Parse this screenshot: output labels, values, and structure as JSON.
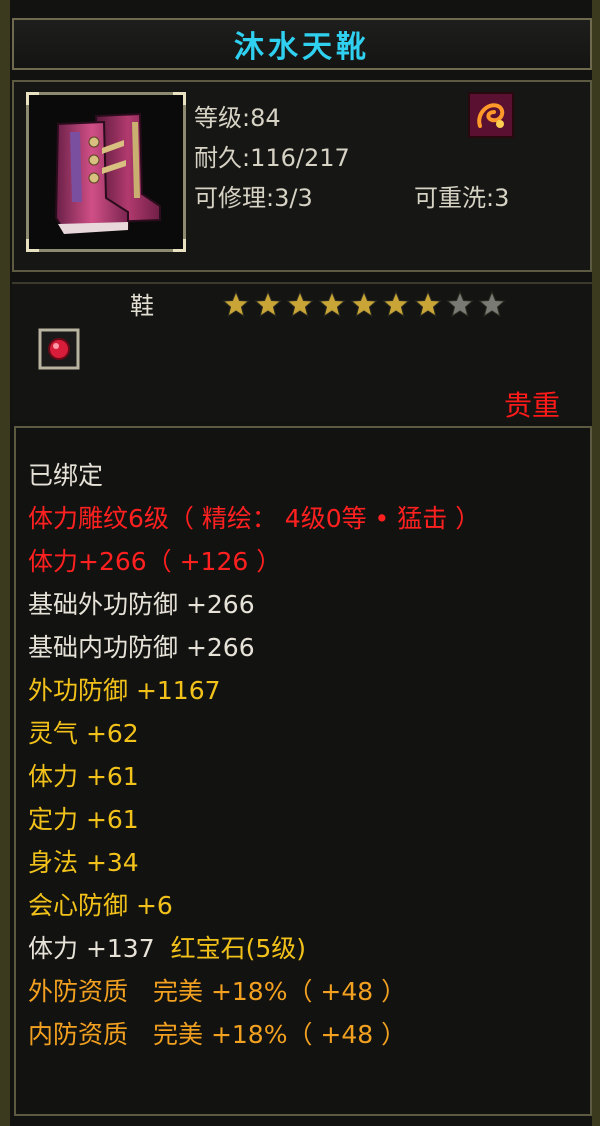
{
  "item": {
    "name": "沐水天靴",
    "level_line": "等级:84",
    "durability_line": "耐久:116/217",
    "repair_line": "可修理:3/3",
    "rewash_line": "可重洗:3",
    "type": "鞋",
    "stars_filled": 7,
    "stars_total": 9,
    "rarity": "贵重"
  },
  "colors": {
    "title": "#2fd0f0",
    "red": "#ff2020",
    "white": "#e6e2d8",
    "yellow": "#f2c21a",
    "orange": "#f2a020",
    "star_gold": "#c9a436",
    "star_gray": "#7a7a74"
  },
  "icons": {
    "item": "boots-icon",
    "rune": "swirl-rune-icon",
    "gem_slot": "red-gem-socket-icon",
    "star": "star-icon"
  },
  "properties": [
    {
      "text": "已绑定",
      "color": "#e6e2d8"
    },
    {
      "text": "体力雕纹6级（ 精绘： 4级0等 • 猛击 ）",
      "color": "#ff2020"
    },
    {
      "text": "体力+266（ +126 ）",
      "color": "#ff2020"
    },
    {
      "text": "基础外功防御 +266",
      "color": "#e6e2d8"
    },
    {
      "text": "基础内功防御 +266",
      "color": "#e6e2d8"
    },
    {
      "text": "外功防御 +1167",
      "color": "#f2c21a"
    },
    {
      "text": "灵气 +62",
      "color": "#f2c21a"
    },
    {
      "text": "体力 +61",
      "color": "#f2c21a"
    },
    {
      "text": "定力 +61",
      "color": "#f2c21a"
    },
    {
      "text": "身法 +34",
      "color": "#f2c21a"
    },
    {
      "text": "会心防御 +6",
      "color": "#f2c21a"
    },
    {
      "text": "体力 +137",
      "color": "#e6e2d8",
      "extra": "红宝石(5级)",
      "extra_color": "#f2c21a"
    },
    {
      "text": "外防资质　完美 +18%（ +48 ）",
      "color": "#f2a020"
    },
    {
      "text": "内防资质　完美 +18%（ +48 ）",
      "color": "#f2a020"
    }
  ]
}
